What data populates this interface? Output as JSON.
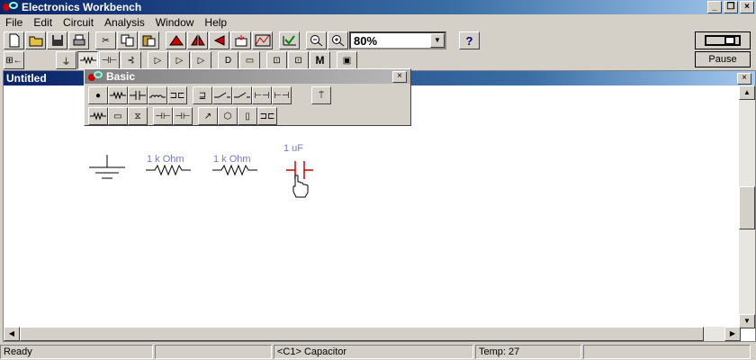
{
  "window": {
    "title": "Electronics Workbench"
  },
  "menu": [
    "File",
    "Edit",
    "Circuit",
    "Analysis",
    "Window",
    "Help"
  ],
  "zoom": {
    "value": "80%"
  },
  "pause_label": "Pause",
  "document": {
    "title": "Untitled"
  },
  "parts_bin": {
    "title": "Basic"
  },
  "circuit": {
    "resistor1_label": "1 k Ohm",
    "resistor2_label": "1 k Ohm",
    "capacitor_label": "1 uF"
  },
  "status": {
    "ready": "Ready",
    "selection": "<C1> Capacitor",
    "temp": "Temp:  27"
  },
  "colors": {
    "title_active": "#0a246a",
    "label": "#7777cc",
    "capacitor": "#cc0000"
  }
}
